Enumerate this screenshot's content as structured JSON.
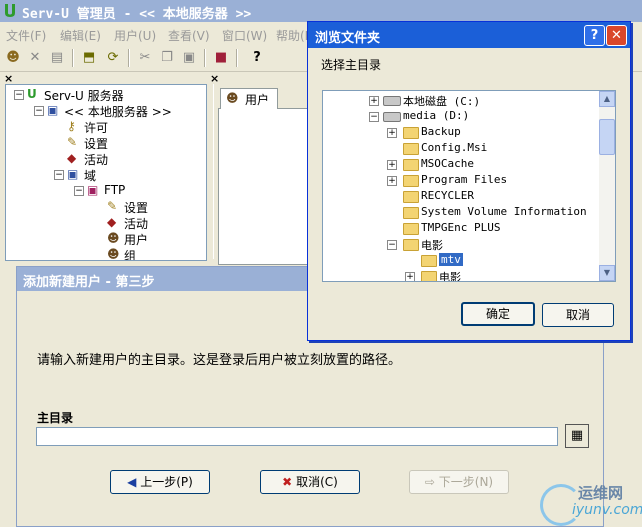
{
  "app": {
    "title": "Serv-U 管理员 - << 本地服务器 >>"
  },
  "menu": [
    "文件(F)",
    "编辑(E)",
    "用户(U)",
    "查看(V)",
    "窗口(W)",
    "帮助(H)"
  ],
  "tree": {
    "root": "Serv-U 服务器",
    "local": "<< 本地服务器 >>",
    "license": "许可",
    "settings": "设置",
    "activity": "活动",
    "domains": "域",
    "ftp": "FTP",
    "ftp_settings": "设置",
    "ftp_activity": "活动",
    "ftp_users": "用户",
    "ftp_groups": "组"
  },
  "right_pane": {
    "tab_label": "用户"
  },
  "wizard": {
    "title": "添加新建用户 - 第三步",
    "message": "请输入新建用户的主目录。这是登录后用户被立刻放置的路径。",
    "field_label": "主目录",
    "home_dir_value": "",
    "prev_label": "上一步(P)",
    "cancel_label": "取消(C)",
    "next_label": "下一步(N)"
  },
  "browse": {
    "title": "浏览文件夹",
    "prompt": "选择主目录",
    "help_label": "?",
    "close_label": "✕",
    "items": [
      {
        "label": "本地磁盘 (C:)",
        "expander": "+"
      },
      {
        "label": "media (D:)",
        "expander": "−"
      },
      {
        "label": "Backup",
        "expander": "+"
      },
      {
        "label": "Config.Msi",
        "expander": ""
      },
      {
        "label": "MSOCache",
        "expander": "+"
      },
      {
        "label": "Program Files",
        "expander": "+"
      },
      {
        "label": "RECYCLER",
        "expander": ""
      },
      {
        "label": "System Volume Information",
        "expander": ""
      },
      {
        "label": "TMPGEnc PLUS",
        "expander": ""
      },
      {
        "label": "电影",
        "expander": "−"
      },
      {
        "label": "mtv",
        "expander": ""
      },
      {
        "label": "电影",
        "expander": "+"
      }
    ],
    "ok_label": "确定",
    "cancel_label": "取消"
  },
  "watermark": {
    "line1": "运维网",
    "line2": "iyunv.com"
  }
}
